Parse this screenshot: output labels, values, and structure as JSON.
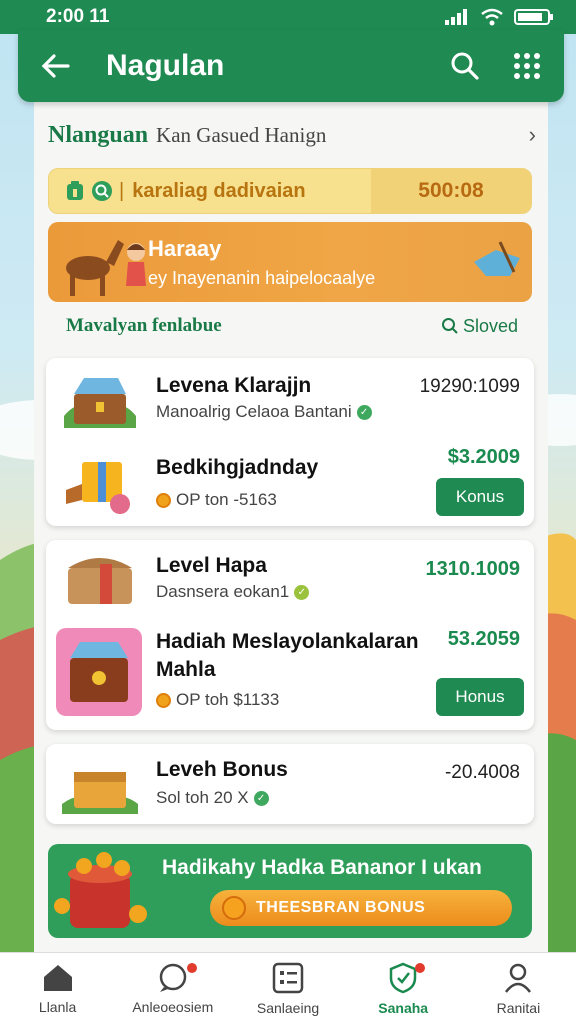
{
  "status_bar": {
    "time": "2:00 11"
  },
  "app_bar": {
    "title": "Nagulan"
  },
  "breadcrumb": {
    "main": "Nlanguan",
    "sub": "Kan Gasued Hanign"
  },
  "search_strip": {
    "text": "karaliag dadivaian",
    "count": "500:08"
  },
  "promo": {
    "title": "Haraay",
    "subtitle": "ey Inayenanin haipelocaalye"
  },
  "section": {
    "label": "Mavalyan fenlabue",
    "sort_label": "Sloved"
  },
  "group1": {
    "row1": {
      "title": "Levena Klarajjn",
      "subtitle": "Manoalrig Celaoa Bantani",
      "value": "19290:1099"
    },
    "row2": {
      "title": "Bedkihgjadnday",
      "subtitle": "OP ton -5163",
      "value": "$3.2009",
      "button": "Konus"
    }
  },
  "group2": {
    "row1": {
      "title": "Level Hapa",
      "subtitle": "Dasnsera eokan1",
      "value": "1310.1009"
    },
    "row2": {
      "title": "Hadiah Meslayolankalaran Mahla",
      "subtitle": "OP toh $1133",
      "value": "53.2059",
      "button": "Honus"
    }
  },
  "group3": {
    "row1": {
      "title": "Leveh Bonus",
      "subtitle": "Sol toh 20 X",
      "value": "-20.4008"
    }
  },
  "bonus_banner": {
    "headline": "Hadikahy Hadka Bananor I ukan",
    "cta": "THEESBRAN BONUS"
  },
  "bottom_nav": [
    {
      "label": "Llanla",
      "icon": "home-icon"
    },
    {
      "label": "Anleoeosiem",
      "icon": "chat-icon"
    },
    {
      "label": "Sanlaeing",
      "icon": "list-icon"
    },
    {
      "label": "Sanaha",
      "icon": "shield-icon"
    },
    {
      "label": "Ranitai",
      "icon": "person-icon"
    }
  ],
  "colors": {
    "primary": "#1f8a52",
    "accent": "#f0a646",
    "value_green": "#1a8a4f"
  }
}
